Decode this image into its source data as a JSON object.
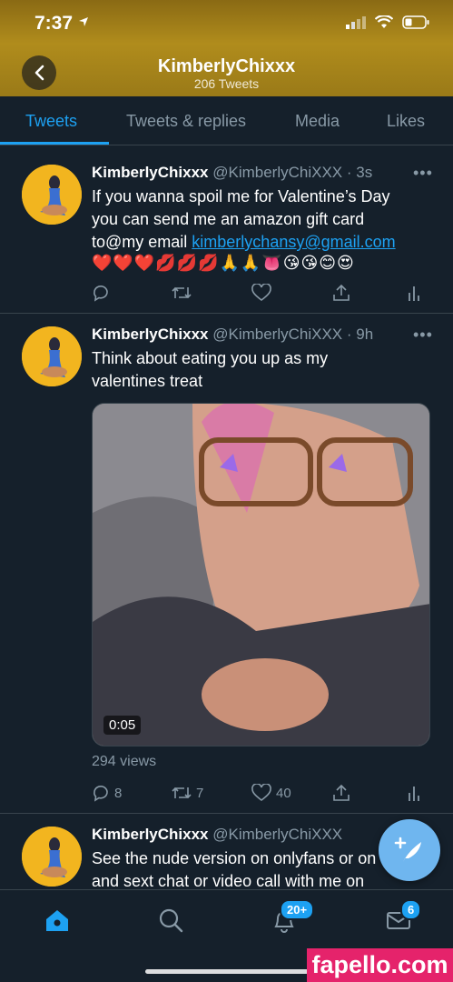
{
  "status": {
    "time": "7:37"
  },
  "header": {
    "title": "KimberlyChixxx",
    "subtitle": "206 Tweets"
  },
  "tabs": [
    {
      "label": "Tweets",
      "active": true
    },
    {
      "label": "Tweets & replies",
      "active": false
    },
    {
      "label": "Media",
      "active": false
    },
    {
      "label": "Likes",
      "active": false
    }
  ],
  "tweets": [
    {
      "name": "KimberlyChixxx",
      "handle": "@KimberlyChiXXX",
      "time": "· 3s",
      "text_lines": [
        "If you wanna spoil me for Valentine’s Day",
        "you can send me an amazon gift card"
      ],
      "text_prefix": "to@my email ",
      "link": "kimberlychansy@gmail.com",
      "emojis": "❤️❤️❤️💋💋💋🙏🙏👅😘😘😊😍"
    },
    {
      "name": "KimberlyChixxx",
      "handle": "@KimberlyChiXXX",
      "time": "· 9h",
      "text_lines": [
        "Think about eating you up as my",
        "valentines treat"
      ],
      "video_time": "0:05",
      "views": "294 views",
      "replies": "8",
      "retweets": "7",
      "likes": "40"
    },
    {
      "name": "KimberlyChixxx",
      "handle": "@KimberlyChiXXX",
      "time": "",
      "text_lines": [
        "See the nude version on onlyfans or on",
        "and sext chat or video call with me on"
      ]
    }
  ],
  "bottom_nav": {
    "notifications_badge": "20+",
    "messages_badge": "6"
  },
  "watermark": "fapello.com",
  "colors": {
    "accent": "#1da1f2",
    "background": "#15202b",
    "header": "#b08c1c"
  }
}
